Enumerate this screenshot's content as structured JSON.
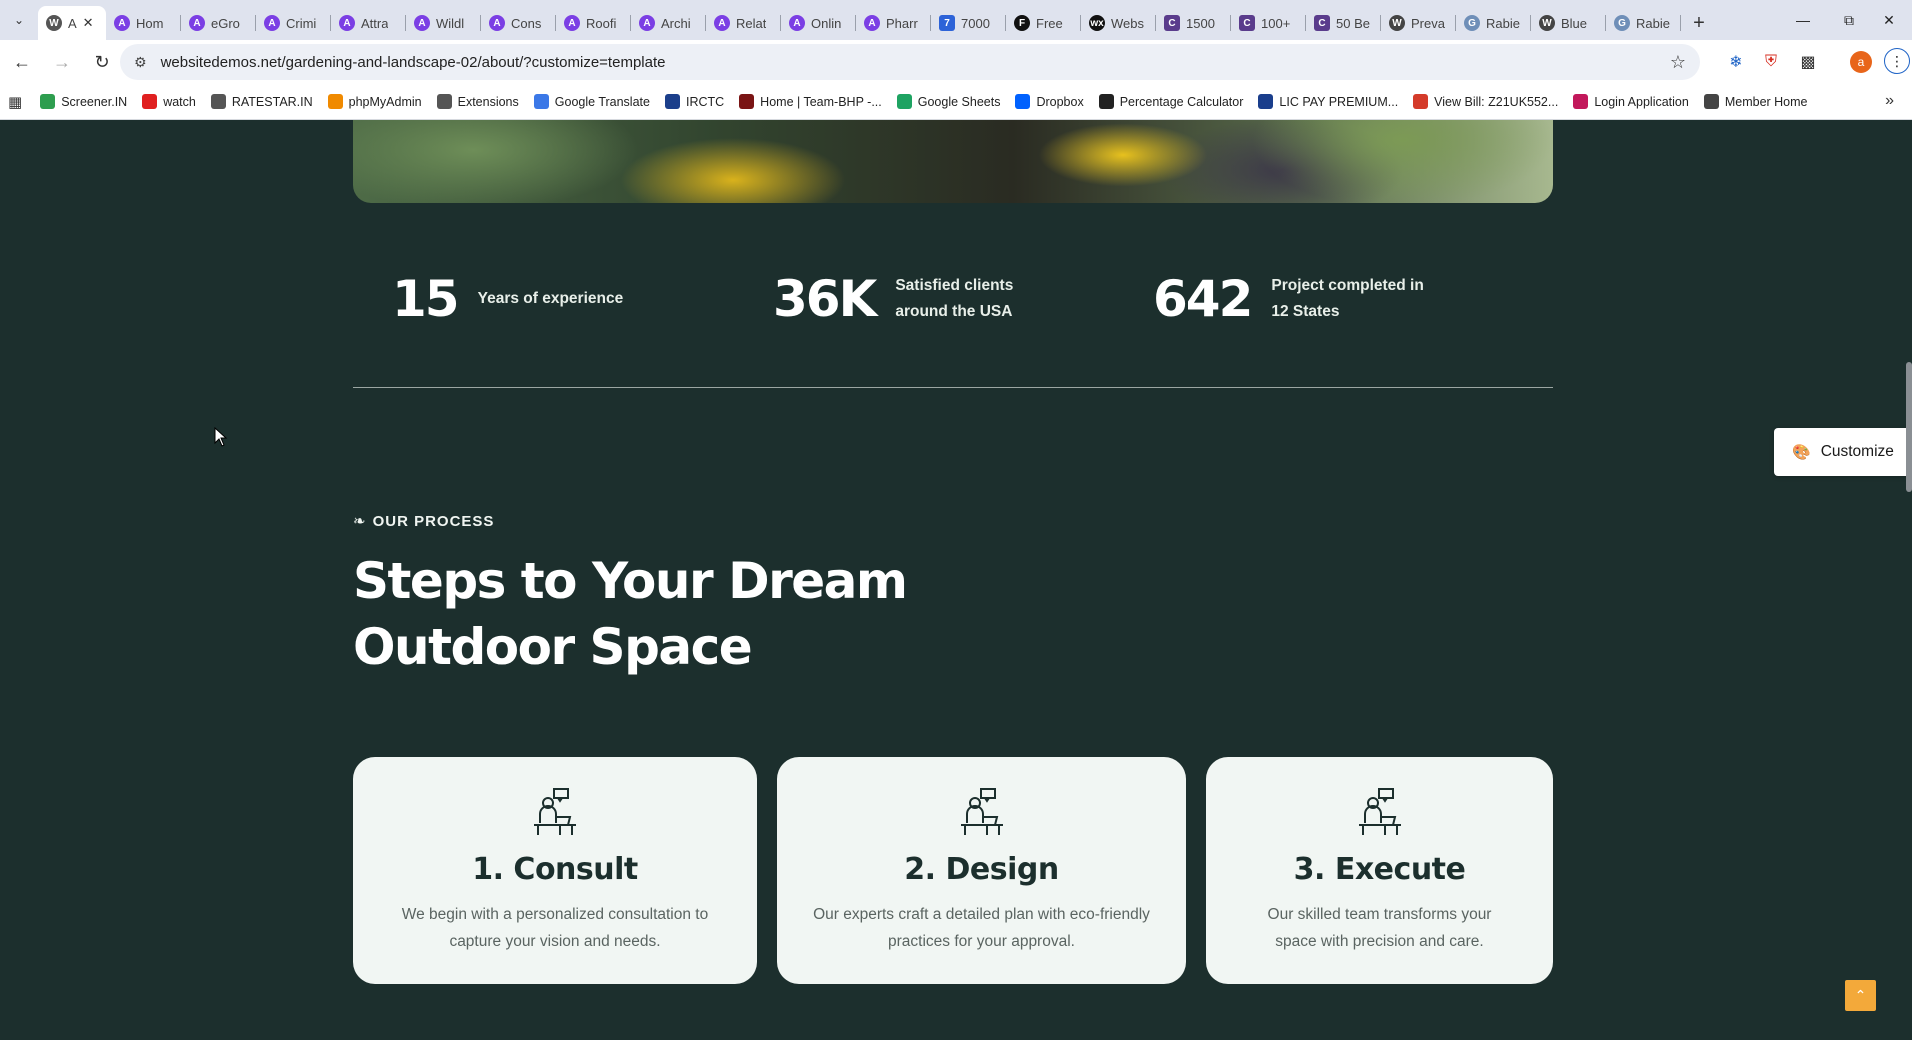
{
  "browser": {
    "tabs": [
      {
        "label": "A",
        "icon": "wordpress-icon",
        "active": true
      },
      {
        "label": "Hom",
        "icon": "astra-icon"
      },
      {
        "label": "eGro",
        "icon": "astra-icon"
      },
      {
        "label": "Crimi",
        "icon": "astra-icon"
      },
      {
        "label": "Attra",
        "icon": "astra-icon"
      },
      {
        "label": "Wildl",
        "icon": "astra-icon"
      },
      {
        "label": "Cons",
        "icon": "astra-icon"
      },
      {
        "label": "Roofi",
        "icon": "astra-icon"
      },
      {
        "label": "Archi",
        "icon": "astra-icon"
      },
      {
        "label": "Relat",
        "icon": "astra-icon"
      },
      {
        "label": "Onlin",
        "icon": "astra-icon"
      },
      {
        "label": "Pharr",
        "icon": "astra-icon"
      },
      {
        "label": "7000",
        "icon": "app-icon"
      },
      {
        "label": "Free",
        "icon": "framer-icon"
      },
      {
        "label": "Webs",
        "icon": "wix-icon"
      },
      {
        "label": "1500",
        "icon": "canva-icon"
      },
      {
        "label": "100+",
        "icon": "canva-icon"
      },
      {
        "label": "50 Be",
        "icon": "canva-icon"
      },
      {
        "label": "Preva",
        "icon": "wikipedia-icon"
      },
      {
        "label": "Rabie",
        "icon": "globe-icon"
      },
      {
        "label": "Blue",
        "icon": "wikipedia-icon"
      },
      {
        "label": "Rabie",
        "icon": "globe-icon"
      }
    ],
    "new_tab": "+",
    "url": "websitedemos.net/gardening-and-landscape-02/about/?customize=template",
    "profile_initial": "a",
    "bookmarks": [
      {
        "label": "Screener.IN",
        "color": "#2e9e4f"
      },
      {
        "label": "watch",
        "color": "#e02020"
      },
      {
        "label": "RATESTAR.IN",
        "color": "#555555"
      },
      {
        "label": "phpMyAdmin",
        "color": "#f08a00"
      },
      {
        "label": "Extensions",
        "color": "#555555"
      },
      {
        "label": "Google Translate",
        "color": "#3b78e7"
      },
      {
        "label": "IRCTC",
        "color": "#1b3f8b"
      },
      {
        "label": "Home | Team-BHP -...",
        "color": "#7a1414"
      },
      {
        "label": "Google Sheets",
        "color": "#1ea362"
      },
      {
        "label": "Dropbox",
        "color": "#0061fe"
      },
      {
        "label": "Percentage Calculator",
        "color": "#222222"
      },
      {
        "label": "LIC PAY PREMIUM...",
        "color": "#1a3e8c"
      },
      {
        "label": "View Bill: Z21UK552...",
        "color": "#d43b2a"
      },
      {
        "label": "Login Application",
        "color": "#c2185b"
      },
      {
        "label": "Member Home",
        "color": "#444444"
      }
    ]
  },
  "stats": [
    {
      "number": "15",
      "label": "Years of experience"
    },
    {
      "number": "36K",
      "label": "Satisfied clients around the USA"
    },
    {
      "number": "642",
      "label": "Project completed in 12 States"
    }
  ],
  "process": {
    "eyebrow": "OUR PROCESS",
    "heading": "Steps to Your Dream Outdoor Space",
    "steps": [
      {
        "title": "1. Consult",
        "text": "We begin with a personalized consultation to capture your vision and needs."
      },
      {
        "title": "2. Design",
        "text": "Our experts craft a detailed plan with eco-friendly practices for your approval."
      },
      {
        "title": "3. Execute",
        "text": "Our skilled team transforms your space with precision and care."
      }
    ]
  },
  "customize_label": "Customize",
  "colors": {
    "page_bg": "#1c2f2d",
    "card_bg": "#f1f6f3",
    "accent": "#f3a93a"
  }
}
